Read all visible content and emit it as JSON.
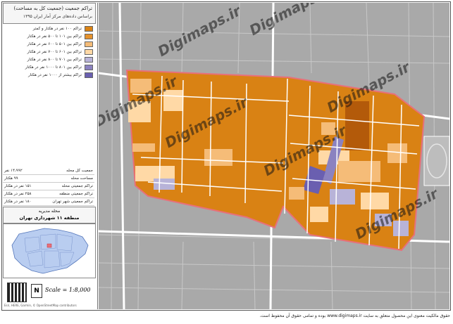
{
  "title": {
    "line1": "تراکم جمعیت (جمعیت کل به مساحت)",
    "line2": "براساس داده‌های مرکز آمار ایران ۱۳۹۵"
  },
  "legend": [
    {
      "label": "تراکم ۱۰۰ نفر در هکتار و کمتر",
      "color": "#d98214"
    },
    {
      "label": "تراکم بین ۱۰۱ تا ۵۰۰ نفر در هکتار",
      "color": "#e6932e"
    },
    {
      "label": "تراکم بین ۵۰۱ تا ۶۰۰ نفر در هکتار",
      "color": "#f5bc78"
    },
    {
      "label": "تراکم بین ۶۰۱ تا ۷۰۰ نفر در هکتار",
      "color": "#ffd9a6"
    },
    {
      "label": "تراکم بین ۷۰۱ تا ۸۰۰ نفر در هکتار",
      "color": "#b8b3d8"
    },
    {
      "label": "تراکم بین ۸۰۱ تا ۱۰۰۰ نفر در هکتار",
      "color": "#8b82c0"
    },
    {
      "label": "تراکم بیشتر از ۱۰۰۰ نفر در هکتار",
      "color": "#6a5fb0"
    }
  ],
  "stats": [
    {
      "label": "جمعیت کل محله",
      "value": "۱۴،۹۹۲ نفر"
    },
    {
      "label": "مساحت محله",
      "value": "۹۹ هکتار"
    },
    {
      "label": "تراکم جمعیتی محله",
      "value": "۱۵۱ نفر در هکتار"
    },
    {
      "label": "تراکم جمعیتی منطقه",
      "value": "۲۵۸ نفر در هکتار"
    },
    {
      "label": "تراکم جمعیتی شهر تهران",
      "value": "۱۸۰ نفر در هکتار"
    }
  ],
  "inset": {
    "neighborhood": "محله مدیریه",
    "district": "منطقه ۱۱ شهرداری تهران"
  },
  "scale": "Scale = 1:8,000",
  "north": "N",
  "credit": "Esri, HERE, Garmin, © OpenStreetMap contributors",
  "footer": "حقوق مالکیت معنوی این محصول متعلق به سایت www.digimaps.ir بوده و تمامی حقوق آن محفوظ است.",
  "watermark": "Digimaps.ir",
  "colors": {
    "base_orange": "#d98214",
    "dark_brown": "#b35a0a",
    "boundary": "#e8707a",
    "basemap": "#a9a9a9",
    "road": "#ffffff"
  }
}
